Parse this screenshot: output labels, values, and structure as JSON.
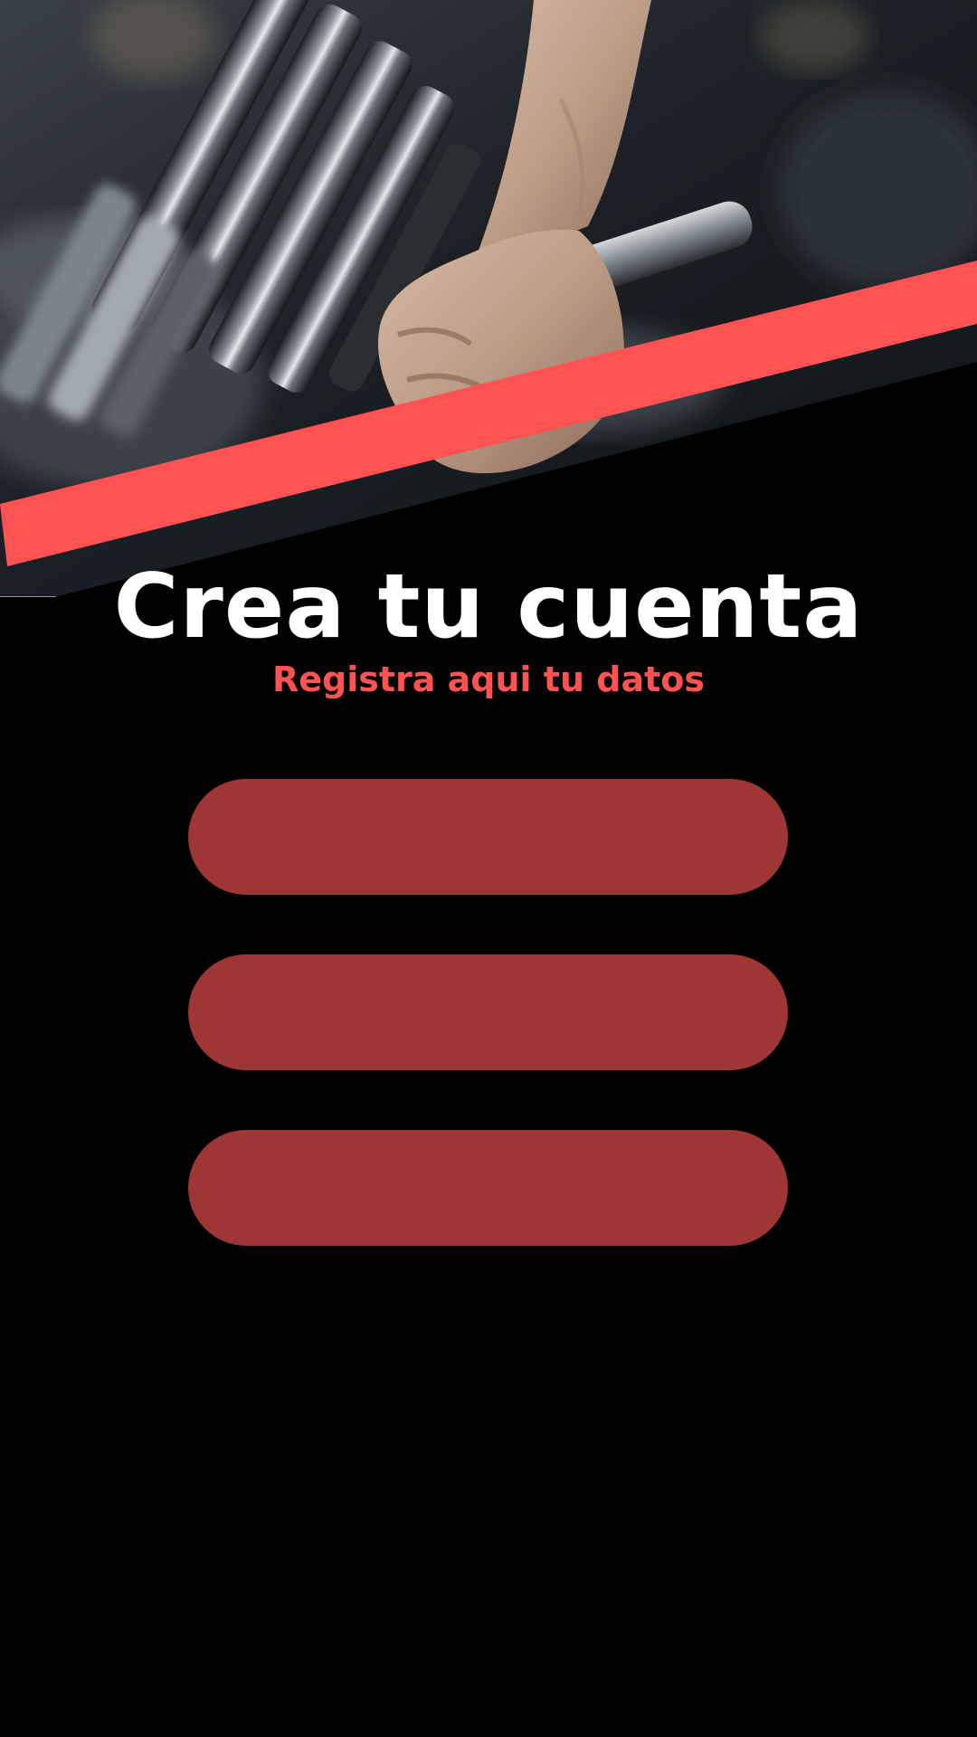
{
  "app": {
    "background_color": "#000000",
    "accent_color": "#ff5252",
    "field_color": "#9e3636"
  },
  "hero": {
    "image": "gym-dumbbell-photo",
    "stripe_color": "#ff5252"
  },
  "header": {
    "title": "Crea tu cuenta",
    "subtitle": "Registra aqui tu datos"
  },
  "form": {
    "fields": [
      {
        "value": "",
        "placeholder": ""
      },
      {
        "value": "",
        "placeholder": ""
      },
      {
        "value": "",
        "placeholder": ""
      }
    ]
  }
}
